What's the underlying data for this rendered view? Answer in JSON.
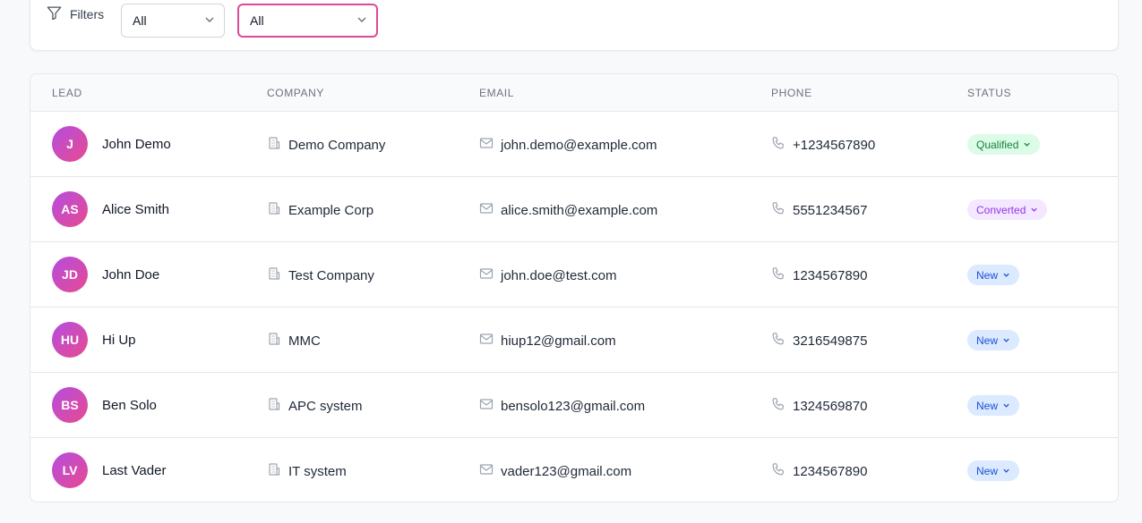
{
  "filters": {
    "label": "Filters",
    "select_1_value": "All",
    "select_2_value": "All"
  },
  "table": {
    "headers": [
      "LEAD",
      "COMPANY",
      "EMAIL",
      "PHONE",
      "STATUS"
    ],
    "rows": [
      {
        "initials": "J",
        "name": "John Demo",
        "company": "Demo Company",
        "email": "john.demo@example.com",
        "phone": "+1234567890",
        "status": "Qualified"
      },
      {
        "initials": "AS",
        "name": "Alice Smith",
        "company": "Example Corp",
        "email": "alice.smith@example.com",
        "phone": "5551234567",
        "status": "Converted"
      },
      {
        "initials": "JD",
        "name": "John Doe",
        "company": "Test Company",
        "email": "john.doe@test.com",
        "phone": "1234567890",
        "status": "New"
      },
      {
        "initials": "HU",
        "name": "Hi Up",
        "company": "MMC",
        "email": "hiup12@gmail.com",
        "phone": "3216549875",
        "status": "New"
      },
      {
        "initials": "BS",
        "name": "Ben Solo",
        "company": "APC system",
        "email": "bensolo123@gmail.com",
        "phone": "1324569870",
        "status": "New"
      },
      {
        "initials": "LV",
        "name": "Last Vader",
        "company": "IT system",
        "email": "vader123@gmail.com",
        "phone": "1234567890",
        "status": "New"
      }
    ]
  },
  "status_colors": {
    "Qualified": {
      "bg": "#dcfce7",
      "fg": "#15803d"
    },
    "Converted": {
      "bg": "#f3e8ff",
      "fg": "#9333ea"
    },
    "New": {
      "bg": "#dbeafe",
      "fg": "#1d4ed8"
    }
  },
  "icons": {
    "filter": "filter-icon",
    "chevron": "chevron-down-icon",
    "company": "building-icon",
    "email": "mail-icon",
    "phone": "phone-icon"
  }
}
